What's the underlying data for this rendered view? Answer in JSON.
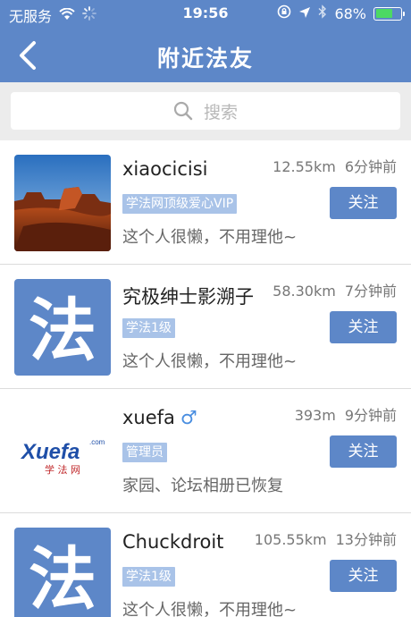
{
  "status": {
    "carrier": "无服务",
    "time": "19:56",
    "battery": "68%",
    "battery_level": 0.68
  },
  "nav": {
    "title": "附近法友"
  },
  "search": {
    "placeholder": "搜索"
  },
  "users": [
    {
      "name": "xiaocicisi",
      "distance": "12.55km",
      "time": "6分钟前",
      "badge": "学法网顶级爱心VIP",
      "signature": "这个人很懒，不用理他~",
      "follow": "关注",
      "avatar": "landscape-photo"
    },
    {
      "name": "究极绅士影溯子",
      "distance": "58.30km",
      "time": "7分钟前",
      "badge": "学法1级",
      "signature": "这个人很懒，不用理他~",
      "follow": "关注",
      "avatar": "fa-logo",
      "avatar_char": "法"
    },
    {
      "name": "xuefa",
      "gender": "♂",
      "distance": "393m",
      "time": "9分钟前",
      "badge": "管理员",
      "signature": "家园、论坛相册已恢复",
      "follow": "关注",
      "avatar": "xuefa-logo",
      "logo_text": "Xuefa",
      "logo_com": ".com",
      "logo_sub": "学 法 网"
    },
    {
      "name": "Chuckdroit",
      "distance": "105.55km",
      "time": "13分钟前",
      "badge": "学法1级",
      "signature": "这个人很懒，不用理他~",
      "follow": "关注",
      "avatar": "fa-logo",
      "avatar_char": "法"
    }
  ]
}
